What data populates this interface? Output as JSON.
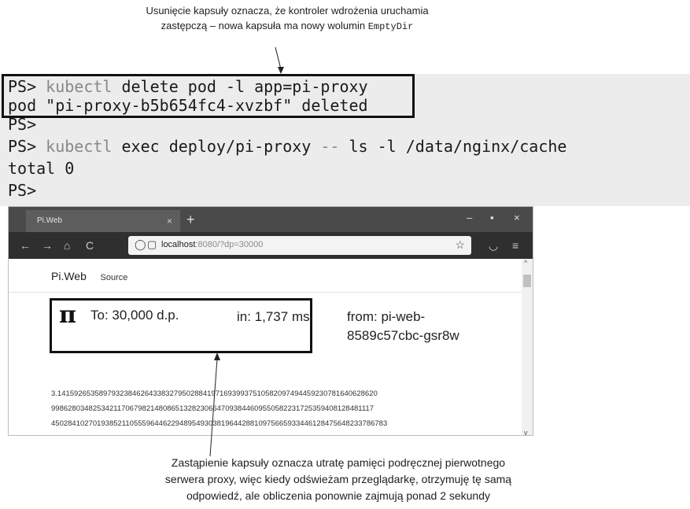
{
  "annotations": {
    "top_line1": "Usunięcie kapsuły oznacza, że kontroler wdrożenia uruchamia",
    "top_line2_prefix": "zastępczą – nowa kapsuła ma nowy wolumin ",
    "top_line2_code": "EmptyDir",
    "bottom_line1": "Zastąpienie kapsuły oznacza utratę pamięci podręcznej pierwotnego",
    "bottom_line2": "serwera proxy, więc kiedy odświeżam przeglądarkę, otrzymuję tę samą",
    "bottom_line3": "odpowiedź, ale obliczenia ponownie zajmują ponad 2 sekundy"
  },
  "terminal": {
    "prompt": "PS>",
    "line1_cmd": "kubectl",
    "line1_args": " delete pod -l app=pi-proxy",
    "line2": "pod \"pi-proxy-b5b654fc4-xvzbf\" deleted",
    "line4_cmd": "kubectl",
    "line4_args_a": " exec deploy/pi-proxy ",
    "line4_dash": "--",
    "line4_args_b": " ls -l /data/nginx/cache",
    "line5": "total 0"
  },
  "browser": {
    "tab_title": "Pi.Web",
    "tab_close": "×",
    "new_tab": "+",
    "minimize": "–",
    "maximize": "▪",
    "close": "×",
    "back": "←",
    "forward": "→",
    "home": "⌂",
    "reload": "C",
    "shield": "◯",
    "page": "▢",
    "url_host": "localhost",
    "url_rest": ":8080/?dp=30000",
    "star": "☆",
    "pocket": "◡",
    "menu": "≡"
  },
  "page": {
    "brand": "Pi.Web",
    "source_link": "Source",
    "pi_symbol": "π",
    "to_text": "To: 30,000 d.p.",
    "in_text": "in: 1,737 ms.",
    "from_text": "from: pi-web-8589c57cbc-gsr8w",
    "digits_line1": "3.14159265358979323846264338327950288419716939937510582097494459230781640628620",
    "digits_line2": "998628034825342117067982148086513282306647093844609550582231725359408128481117",
    "digits_line3": "450284102701938521105559644622948954930381964428810975665933446128475648233786783"
  },
  "colors": {
    "terminal_bg": "#ececec",
    "tabbar_bg": "#4a4a4a",
    "navbar_bg": "#2f2f2f",
    "highlight_border": "#111111"
  },
  "icons": [
    "close-icon",
    "plus-icon",
    "minimize-icon",
    "maximize-icon",
    "back-arrow-icon",
    "forward-arrow-icon",
    "home-icon",
    "reload-icon",
    "shield-icon",
    "page-icon",
    "star-icon",
    "pocket-icon",
    "menu-icon",
    "pi-icon"
  ]
}
